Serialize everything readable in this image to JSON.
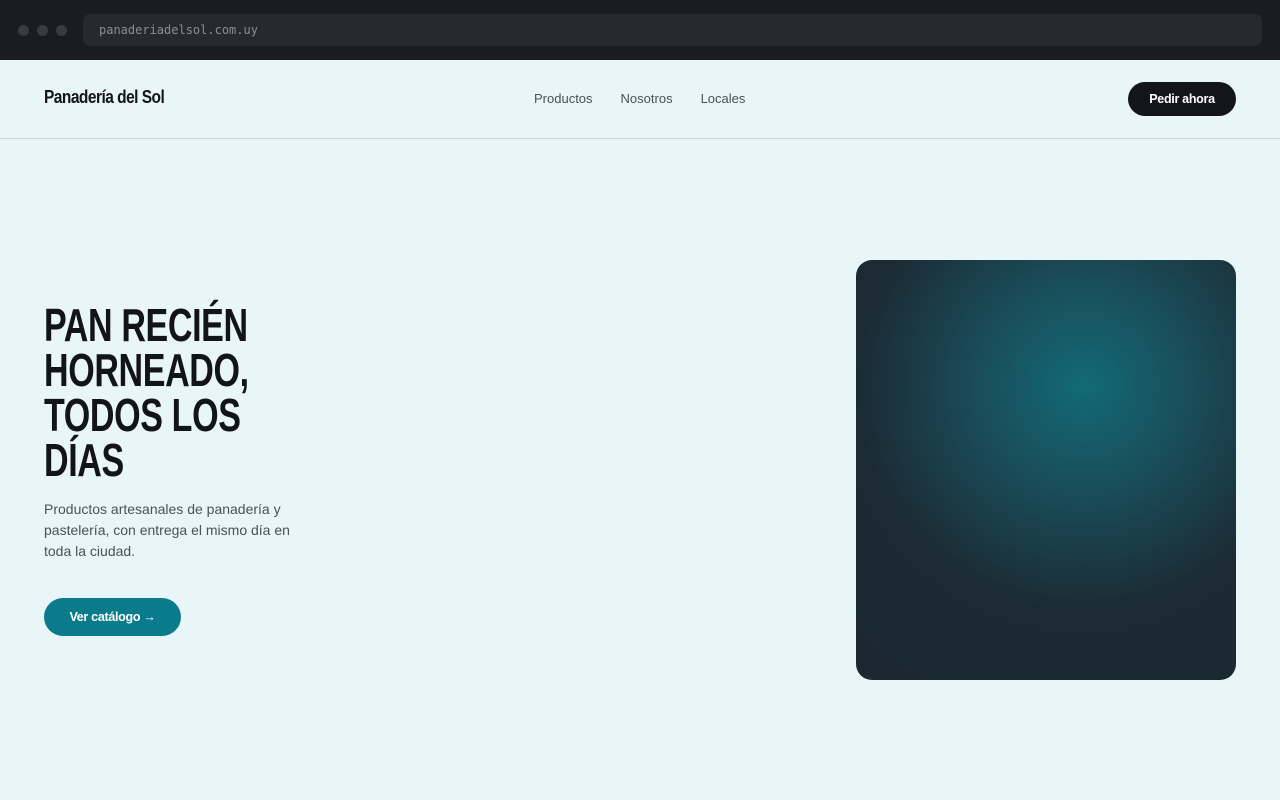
{
  "browser": {
    "url": "panaderiadelsol.com.uy"
  },
  "header": {
    "logo": "Panadería del Sol",
    "nav": [
      {
        "label": "Productos"
      },
      {
        "label": "Nosotros"
      },
      {
        "label": "Locales"
      }
    ],
    "cta_label": "Pedir ahora"
  },
  "hero": {
    "title_lines": [
      "PAN RECIÉN",
      "HORNEADO,",
      "TODOS LOS",
      "DÍAS"
    ],
    "description": "Productos artesanales de panadería y pastelería, con entrega el mismo día en toda la ciudad.",
    "cta_label": "Ver catálogo →"
  },
  "colors": {
    "background": "#e8f6f7",
    "accent": "#0a7b8a",
    "dark": "#131518"
  }
}
